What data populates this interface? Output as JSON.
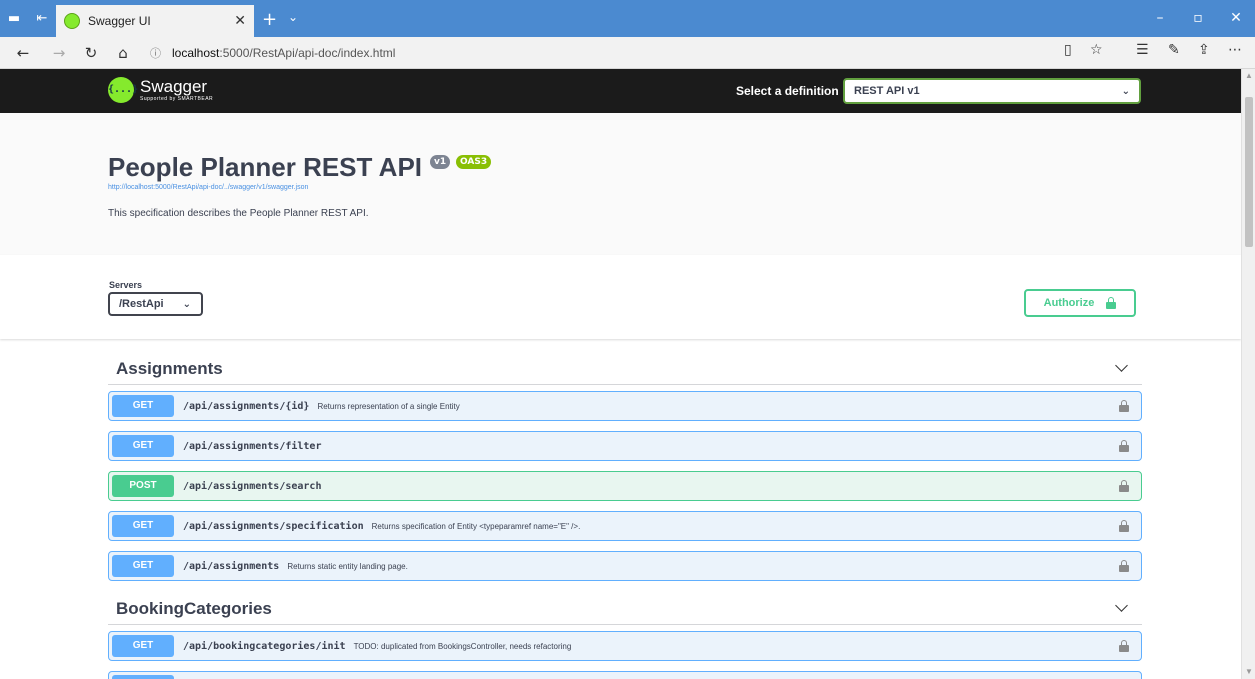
{
  "browser": {
    "tab_title": "Swagger UI",
    "url_host": "localhost",
    "url_path": ":5000/RestApi/api-doc/index.html"
  },
  "topbar": {
    "logo_text": "Swagger",
    "logo_subtext": "Supported by SMARTBEAR",
    "logo_mark": "{...}",
    "definition_label": "Select a definition",
    "definition_value": "REST API v1"
  },
  "info": {
    "title": "People Planner REST API",
    "version_badge": "v1",
    "oas_badge": "OAS3",
    "spec_link": "http://localhost:5000/RestApi/api-doc/../swagger/v1/swagger.json",
    "description": "This specification describes the People Planner REST API."
  },
  "servers": {
    "label": "Servers",
    "selected": "/RestApi"
  },
  "authorize": {
    "label": "Authorize"
  },
  "tags": [
    {
      "name": "Assignments",
      "operations": [
        {
          "method": "GET",
          "path": "/api/assignments/{id}",
          "summary": "Returns representation of a single Entity"
        },
        {
          "method": "GET",
          "path": "/api/assignments/filter",
          "summary": ""
        },
        {
          "method": "POST",
          "path": "/api/assignments/search",
          "summary": ""
        },
        {
          "method": "GET",
          "path": "/api/assignments/specification",
          "summary": "Returns specification of Entity <typeparamref name=\"E\" />."
        },
        {
          "method": "GET",
          "path": "/api/assignments",
          "summary": "Returns static entity landing page."
        }
      ]
    },
    {
      "name": "BookingCategories",
      "operations": [
        {
          "method": "GET",
          "path": "/api/bookingcategories/init",
          "summary": "TODO: duplicated from BookingsController, needs refactoring"
        }
      ]
    }
  ]
}
